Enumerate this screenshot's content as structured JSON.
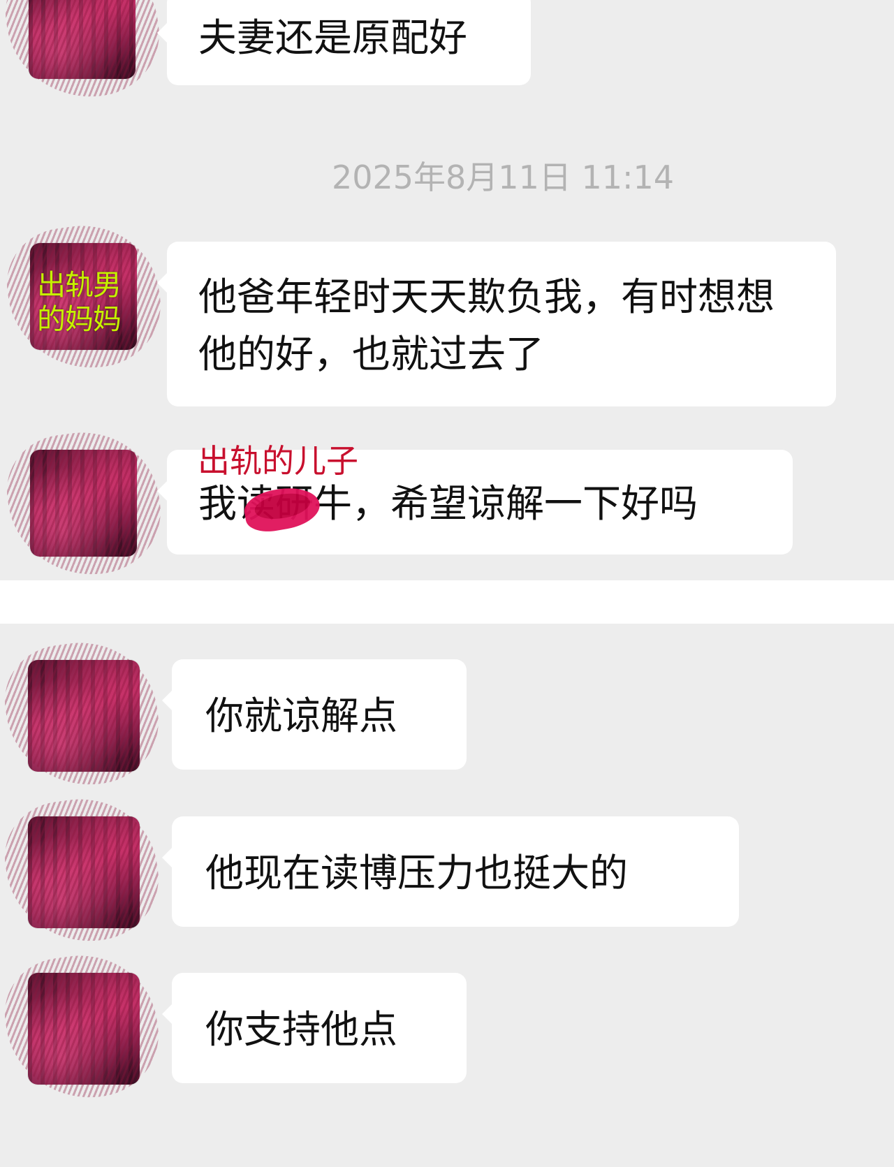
{
  "chat": {
    "timestamp": "2025年8月11日 11:14",
    "annotation_label": "出轨的儿子",
    "avatar_overlay_line1": "出轨男",
    "avatar_overlay_line2": "的妈妈",
    "messages": [
      {
        "text": "夫妻还是原配好"
      },
      {
        "text": "他爸年轻时天天欺负我，有时想想他的好，也就过去了"
      },
      {
        "text": "我读研牛，希望谅解一下好吗"
      },
      {
        "text": "你就谅解点"
      },
      {
        "text": "他现在读博压力也挺大的"
      },
      {
        "text": "你支持他点"
      }
    ],
    "colors": {
      "background": "#ededed",
      "bubble": "#ffffff",
      "annotation": "#c8102e",
      "overlay_text": "#c6f000",
      "redaction": "#e0125a",
      "timestamp": "#b3b3b3"
    }
  }
}
